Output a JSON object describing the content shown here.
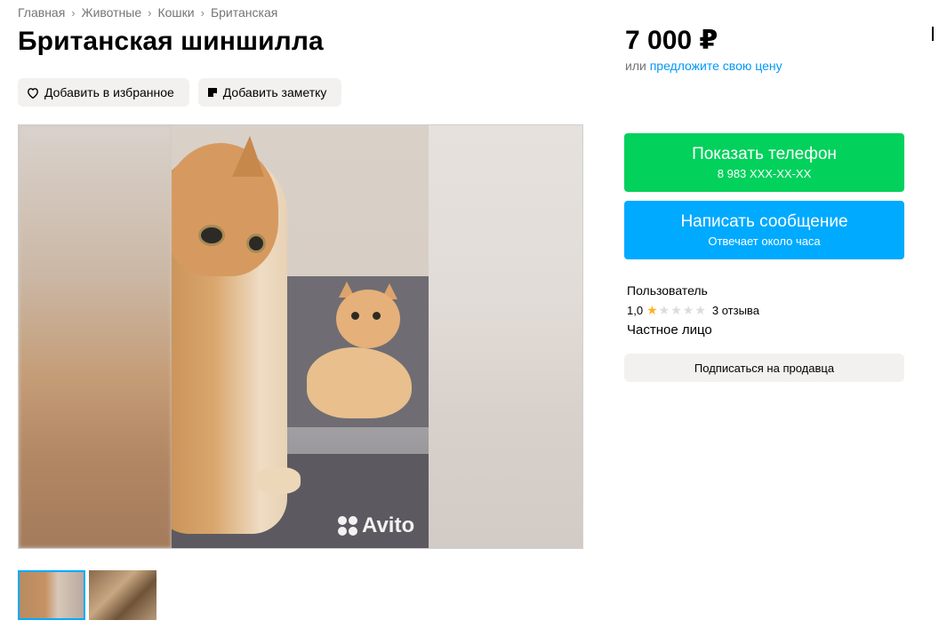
{
  "breadcrumb": [
    "Главная",
    "Животные",
    "Кошки",
    "Британская"
  ],
  "title": "Британская шиншилла",
  "actions": {
    "favorite_label": "Добавить в избранное",
    "note_label": "Добавить заметку"
  },
  "gallery": {
    "watermark": "Avito",
    "thumbnail_count": 2,
    "active_thumbnail": 1
  },
  "price": {
    "value": "7 000 ₽",
    "or_text": "или",
    "offer_link": "предложите свою цену"
  },
  "contact": {
    "phone_label": "Показать телефон",
    "phone_masked": "8 983 XXX-XX-XX",
    "message_label": "Написать сообщение",
    "message_sub": "Отвечает около часа"
  },
  "seller": {
    "name": "Пользователь",
    "rating": "1,0",
    "rating_value": 1,
    "rating_max": 5,
    "reviews": "3 отзыва",
    "type": "Частное лицо",
    "subscribe_label": "Подписаться на продавца"
  },
  "colors": {
    "phone_button": "#02d15c",
    "message_button": "#00aaff",
    "link": "#0099f7",
    "star": "#ffb021"
  }
}
